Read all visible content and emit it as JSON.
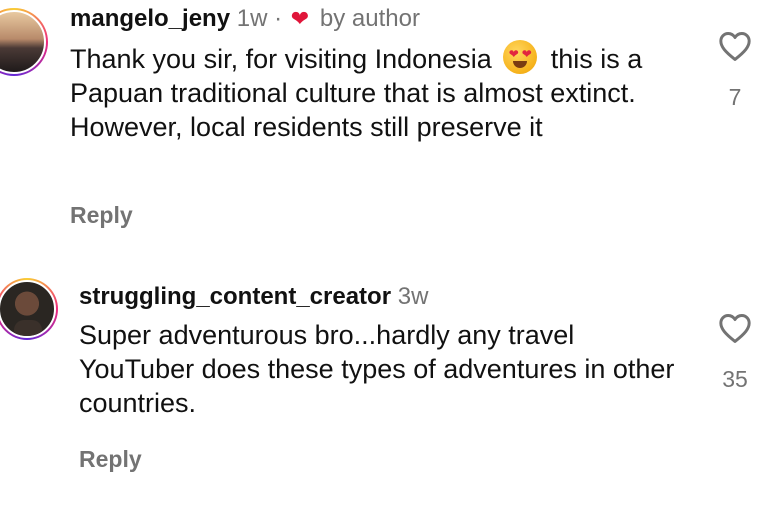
{
  "comments": [
    {
      "username": "mangelo_jeny",
      "time": "1w",
      "separator": "·",
      "liked_by_author_label": "by author",
      "text_before_emoji": "Thank you sir, for visiting Indonesia",
      "emoji": "heart-eyes-emoji",
      "text_after_emoji": "this is a Papuan traditional culture that is almost extinct. However, local residents still preserve it",
      "reply_label": "Reply",
      "like_icon": "heart-outline-icon",
      "like_count": "7"
    },
    {
      "username": "struggling_content_creator",
      "time": "3w",
      "text": "Super adventurous bro...hardly any travel YouTuber does these types of adventures in other countries.",
      "reply_label": "Reply",
      "like_icon": "heart-outline-icon",
      "like_count": "35"
    }
  ],
  "colors": {
    "text": "#111111",
    "muted": "#737373",
    "author_heart": "#e0163a"
  }
}
